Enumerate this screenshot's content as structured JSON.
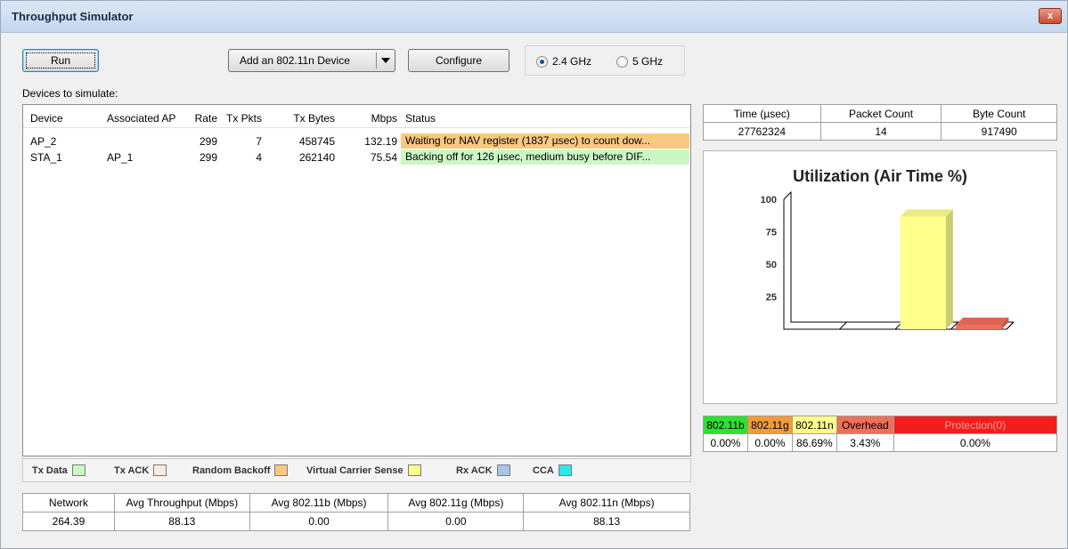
{
  "window": {
    "title": "Throughput Simulator",
    "close_glyph": "x"
  },
  "toolbar": {
    "run_label": "Run",
    "add_device_label": "Add an 802.11n Device",
    "configure_label": "Configure",
    "band_options": [
      {
        "label": "2.4 GHz",
        "selected": true
      },
      {
        "label": "5 GHz",
        "selected": false
      }
    ]
  },
  "devices": {
    "caption": "Devices to simulate:",
    "columns": [
      "Device",
      "Associated AP",
      "Rate",
      "Tx Pkts",
      "Tx Bytes",
      "Mbps",
      "Status"
    ],
    "rows": [
      {
        "device": "AP_2",
        "ap": "",
        "rate": "299",
        "tx_pkts": "7",
        "tx_bytes": "458745",
        "mbps": "132.19",
        "status": "Waiting for NAV register (1837 µsec) to count dow...",
        "status_color": "#f9c97f"
      },
      {
        "device": "STA_1",
        "ap": "AP_1",
        "rate": "299",
        "tx_pkts": "4",
        "tx_bytes": "262140",
        "mbps": "75.54",
        "status": "Backing off for 126 µsec, medium busy before DIF...",
        "status_color": "#ccf7c4"
      }
    ]
  },
  "legend": [
    {
      "label": "Tx Data",
      "color": "#ccf7c4"
    },
    {
      "label": "Tx ACK",
      "color": "#fbe9e3"
    },
    {
      "label": "Random Backoff",
      "color": "#f9c97f"
    },
    {
      "label": "Virtual Carrier Sense",
      "color": "#ffff8c"
    },
    {
      "label": "Rx ACK",
      "color": "#a9c4e8"
    },
    {
      "label": "CCA",
      "color": "#2ce7ef"
    }
  ],
  "summary": {
    "headers": [
      "Network",
      "Avg Throughput (Mbps)",
      "Avg 802.11b (Mbps)",
      "Avg 802.11g (Mbps)",
      "Avg 802.11n (Mbps)"
    ],
    "values": [
      "264.39",
      "88.13",
      "0.00",
      "0.00",
      "88.13"
    ]
  },
  "stats": {
    "headers": [
      "Time (µsec)",
      "Packet Count",
      "Byte Count"
    ],
    "values": [
      "27762324",
      "14",
      "917490"
    ]
  },
  "chart_data": {
    "type": "bar",
    "title": "Utilization (Air Time %)",
    "categories": [
      "802.11b",
      "802.11g",
      "802.11n",
      "Overhead"
    ],
    "values": [
      0.0,
      0.0,
      86.69,
      3.43
    ],
    "colors": [
      "#2ee12e",
      "#f39a3a",
      "#ffff8c",
      "#ee6f5a"
    ],
    "yticks": [
      25,
      50,
      75,
      100
    ],
    "ylim": [
      0,
      100
    ],
    "style": "3d"
  },
  "breakdown": {
    "headers": [
      {
        "label": "802.11b",
        "bg": "#2ee12e",
        "fg": "#000000"
      },
      {
        "label": "802.11g",
        "bg": "#f39a3a",
        "fg": "#000000"
      },
      {
        "label": "802.11n",
        "bg": "#ffff8c",
        "fg": "#000000"
      },
      {
        "label": "Overhead",
        "bg": "#ee6f5a",
        "fg": "#000000"
      },
      {
        "label": "Protection(0)",
        "bg": "#f21d1d",
        "fg": "#ff9a9a"
      }
    ],
    "values": [
      "0.00%",
      "0.00%",
      "86.69%",
      "3.43%",
      "0.00%"
    ]
  }
}
